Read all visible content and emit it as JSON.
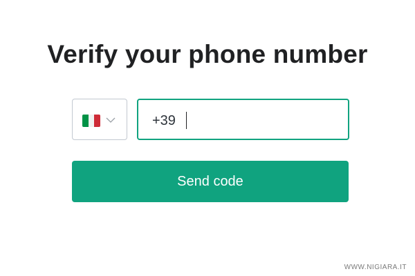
{
  "page": {
    "title": "Verify your phone number"
  },
  "phone": {
    "country": {
      "flag_icon": "italy-flag-icon",
      "flag_colors": [
        "#009246",
        "#f1f2f1",
        "#ce2b37"
      ],
      "dropdown_icon": "chevron-down-icon"
    },
    "dial_code": "+39",
    "value": ""
  },
  "actions": {
    "send_label": "Send code"
  },
  "watermark": "WWW.NIGIARA.IT",
  "colors": {
    "accent": "#10a37f",
    "text": "#202123",
    "border": "#c2c8d0"
  }
}
